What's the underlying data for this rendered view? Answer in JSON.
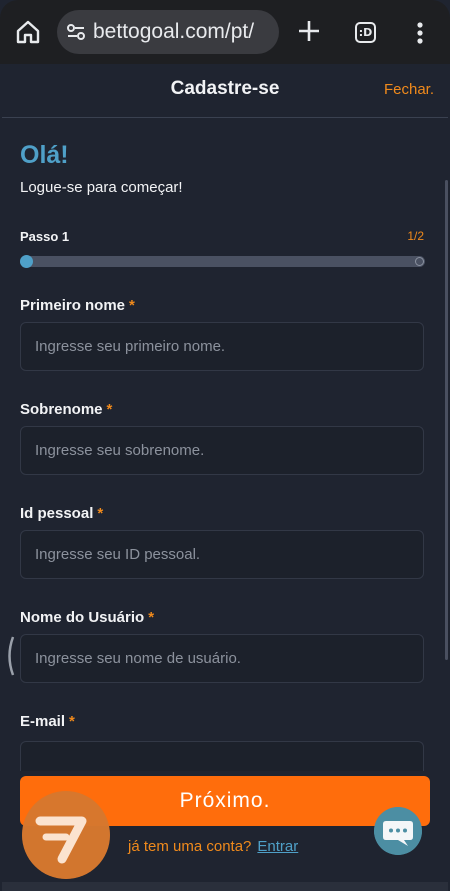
{
  "browser": {
    "url": "bettogoal.com/pt/",
    "tabs_count": ":D"
  },
  "sheet": {
    "title": "Cadastre-se",
    "close_label": "Fechar."
  },
  "intro": {
    "greeting": "Olá!",
    "subtitle": "Logue-se para começar!"
  },
  "progress": {
    "step_label": "Passo 1",
    "step_count": "1/2",
    "fraction": 0.5
  },
  "fields": [
    {
      "label": "Primeiro nome",
      "required_mark": "*",
      "placeholder": "Ingresse seu primeiro nome.",
      "value": ""
    },
    {
      "label": "Sobrenome",
      "required_mark": "*",
      "placeholder": "Ingresse seu sobrenome.",
      "value": ""
    },
    {
      "label": "Id pessoal",
      "required_mark": "*",
      "placeholder": "Ingresse seu ID pessoal.",
      "value": ""
    },
    {
      "label": "Nome do Usuário",
      "required_mark": "*",
      "placeholder": "Ingresse seu nome de usuário.",
      "value": ""
    },
    {
      "label": "E-mail",
      "required_mark": "*",
      "placeholder": "",
      "value": ""
    }
  ],
  "actions": {
    "next_label": "Próximo.",
    "account_question": "já tem uma conta?",
    "login_label": "Entrar"
  },
  "colors": {
    "accent_orange": "#ff6d0c",
    "accent_blue": "#4fa0c8",
    "background": "#1f2430"
  },
  "icons": {
    "home": "home-icon",
    "site_settings": "tune-icon",
    "new_tab": "plus-icon",
    "tabs": "tabs-icon",
    "menu": "more-vertical-icon",
    "logo": "brand-logo-icon",
    "chat": "chat-bubble-icon"
  }
}
